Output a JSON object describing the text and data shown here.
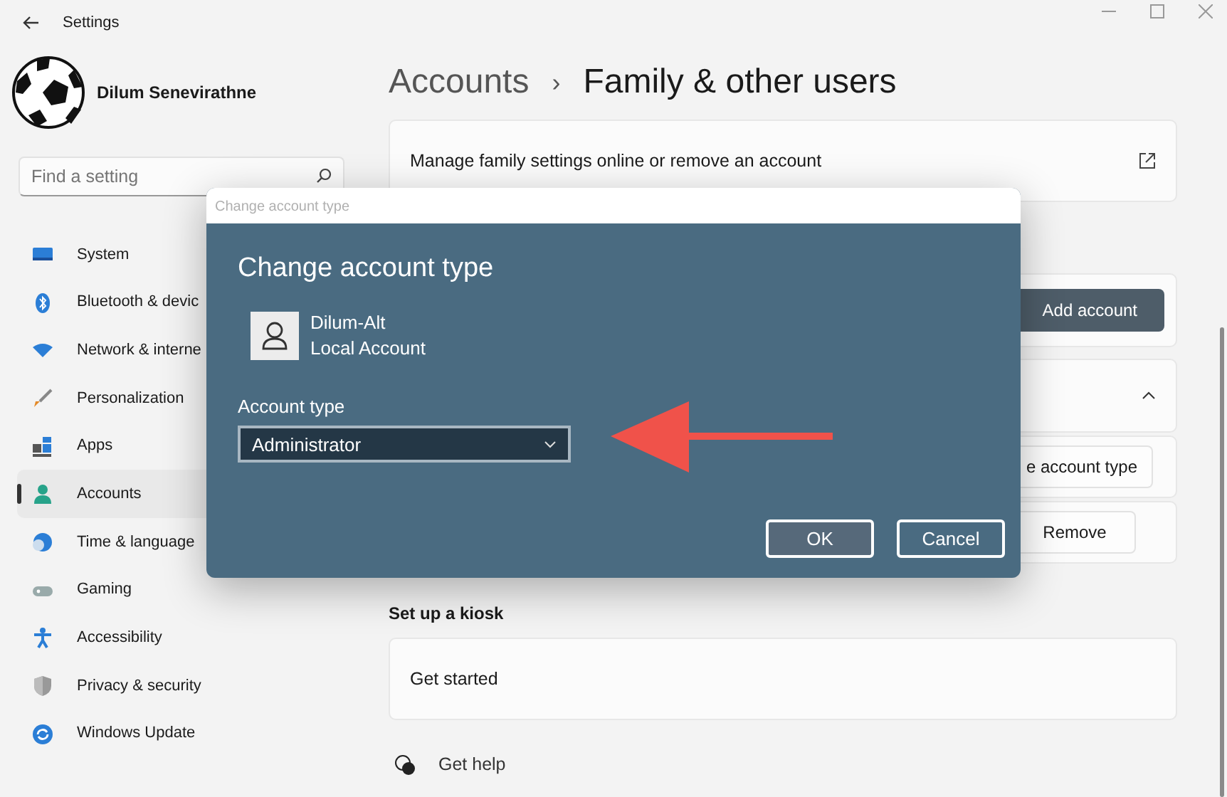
{
  "window": {
    "title": "Settings"
  },
  "profile": {
    "name": "Dilum Senevirathne"
  },
  "search": {
    "placeholder": "Find a setting"
  },
  "nav": [
    {
      "label": "System",
      "selected": false
    },
    {
      "label": "Bluetooth & devic",
      "selected": false
    },
    {
      "label": "Network & interne",
      "selected": false
    },
    {
      "label": "Personalization",
      "selected": false
    },
    {
      "label": "Apps",
      "selected": false
    },
    {
      "label": "Accounts",
      "selected": true
    },
    {
      "label": "Time & language",
      "selected": false
    },
    {
      "label": "Gaming",
      "selected": false
    },
    {
      "label": "Accessibility",
      "selected": false
    },
    {
      "label": "Privacy & security",
      "selected": false
    },
    {
      "label": "Windows Update",
      "selected": false
    }
  ],
  "breadcrumb": {
    "parent": "Accounts",
    "separator": "›",
    "current": "Family & other users"
  },
  "family_card": {
    "text": "Manage family settings online or remove an account"
  },
  "add_account": {
    "button": "Add account"
  },
  "account_card": {
    "expanded": true,
    "buttons": [
      "e account type",
      "Remove"
    ]
  },
  "kiosk": {
    "heading": "Set up a kiosk",
    "row": "Get started"
  },
  "help": {
    "label": "Get help"
  },
  "dialog": {
    "titlebar": "Change account type",
    "heading": "Change account type",
    "user": {
      "name": "Dilum-Alt",
      "type": "Local Account"
    },
    "field_label": "Account type",
    "select": {
      "value": "Administrator"
    },
    "buttons": [
      {
        "label": "OK",
        "primary": true
      },
      {
        "label": "Cancel",
        "primary": false
      }
    ]
  }
}
